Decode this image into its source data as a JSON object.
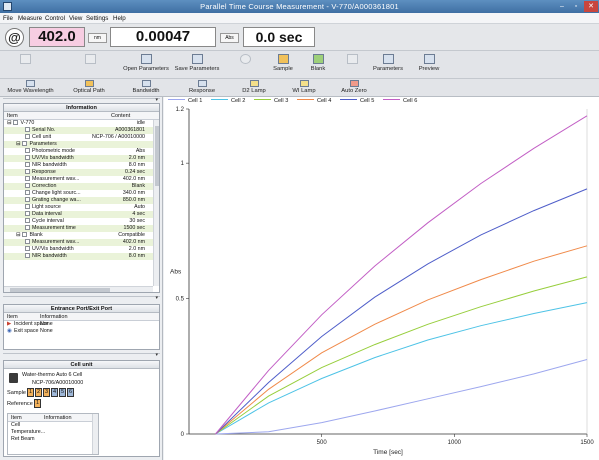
{
  "window": {
    "title": "Parallel Time Course Measurement - V-770/A000361801",
    "minimize": "–",
    "maximize": "▫",
    "close": "✕"
  },
  "menu": [
    "File",
    "Measure",
    "Control",
    "View",
    "Settings",
    "Help"
  ],
  "readout": {
    "logo": "@",
    "wavelength": "402.0",
    "wavelength_unit": "nm",
    "abs_value": "0.00047",
    "abs_unit": "Abs",
    "time": "0.0 sec"
  },
  "toolbar": {
    "items": [
      {
        "label": "",
        "icon": "measure-icon",
        "enabled": false
      },
      {
        "label": "",
        "icon": "table-icon",
        "enabled": false
      },
      {
        "label": "Open Parameters",
        "icon": "folder-open-icon",
        "enabled": true
      },
      {
        "label": "Save Parameters",
        "icon": "save-icon",
        "enabled": true
      },
      {
        "label": "",
        "icon": "stop-icon",
        "enabled": false
      },
      {
        "label": "Sample",
        "icon": "sample-icon",
        "enabled": true
      },
      {
        "label": "Blank",
        "icon": "blank-icon",
        "enabled": true
      },
      {
        "label": "",
        "icon": "print-icon",
        "enabled": false
      },
      {
        "label": "Parameters",
        "icon": "parameters-icon",
        "enabled": true
      },
      {
        "label": "Preview",
        "icon": "preview-icon",
        "enabled": true
      }
    ]
  },
  "toolbar2": {
    "items": [
      "Move Wavelength",
      "Optical Path",
      "Bandwidth",
      "Response",
      "D2 Lamp",
      "WI Lamp",
      "Auto Zero"
    ]
  },
  "information": {
    "title": "Information",
    "col_item": "Item",
    "col_content": "Content",
    "rows": [
      {
        "name": "V-770",
        "value": "idle",
        "indent": 0
      },
      {
        "name": "Serial No.",
        "value": "A000361801",
        "indent": 2
      },
      {
        "name": "Cell unit",
        "value": "NCP-706 / A00010000",
        "indent": 2
      },
      {
        "name": "Parameters",
        "value": "",
        "indent": 1
      },
      {
        "name": "Photometric mode",
        "value": "Abs",
        "indent": 2
      },
      {
        "name": "UV/Vis bandwidth",
        "value": "2.0 nm",
        "indent": 2
      },
      {
        "name": "NIR bandwidth",
        "value": "8.0 nm",
        "indent": 2
      },
      {
        "name": "Response",
        "value": "0.24 sec",
        "indent": 2
      },
      {
        "name": "Measurement wav...",
        "value": "402.0 nm",
        "indent": 2
      },
      {
        "name": "Correction",
        "value": "Blank",
        "indent": 2
      },
      {
        "name": "Change light sourc...",
        "value": "340.0 nm",
        "indent": 2
      },
      {
        "name": "Grating change wa...",
        "value": "850.0 nm",
        "indent": 2
      },
      {
        "name": "Light source",
        "value": "Auto",
        "indent": 2
      },
      {
        "name": "Data interval",
        "value": "4 sec",
        "indent": 2
      },
      {
        "name": "Cycle interval",
        "value": "30 sec",
        "indent": 2
      },
      {
        "name": "Measurement time",
        "value": "1500 sec",
        "indent": 2
      },
      {
        "name": "Blank",
        "value": "Compatible",
        "indent": 1
      },
      {
        "name": "Measurement wav...",
        "value": "402.0 nm",
        "indent": 2
      },
      {
        "name": "UV/Vis bandwidth",
        "value": "2.0 nm",
        "indent": 2
      },
      {
        "name": "NIR bandwidth",
        "value": "8.0 nm",
        "indent": 2
      }
    ]
  },
  "port": {
    "title": "Entrance Port/Exit Port",
    "col_item": "Item",
    "col_info": "Information",
    "rows": [
      {
        "name": "Incident space",
        "value": "None"
      },
      {
        "name": "Exit space",
        "value": "None"
      }
    ]
  },
  "cellunit": {
    "title": "Cell unit",
    "name": "Water-thermo Auto 6 Cell",
    "model": "NCP-706/A00010000",
    "sample_label": "Sample",
    "sample_cells": [
      "1",
      "2",
      "3",
      "4",
      "5",
      "6"
    ],
    "reference_label": "Reference",
    "reference_cells": [
      "1"
    ],
    "col_item": "Item",
    "col_info": "Information",
    "rows": [
      "Cell",
      "Temperature...",
      "Ret Beam"
    ]
  },
  "chart_data": {
    "type": "line",
    "x_label": "Time [sec]",
    "y_label": "Abs",
    "xlim": [
      0,
      1500
    ],
    "ylim": [
      0,
      1.2
    ],
    "x_ticks": [
      500,
      1000,
      1500
    ],
    "y_ticks": [
      0,
      0.5,
      1,
      1.2
    ],
    "legend_placement": "top",
    "series": [
      {
        "name": "Cell 1",
        "color": "#9da7ee",
        "x": [
          100,
          300,
          500,
          700,
          900,
          1100,
          1300,
          1500
        ],
        "y": [
          0,
          0.008,
          0.042,
          0.085,
          0.13,
          0.175,
          0.222,
          0.275
        ]
      },
      {
        "name": "Cell 2",
        "color": "#4ec3e6",
        "x": [
          100,
          300,
          500,
          700,
          900,
          1100,
          1300,
          1500
        ],
        "y": [
          0,
          0.115,
          0.205,
          0.282,
          0.347,
          0.4,
          0.445,
          0.485
        ]
      },
      {
        "name": "Cell 3",
        "color": "#97ce3c",
        "x": [
          100,
          300,
          500,
          700,
          900,
          1100,
          1300,
          1500
        ],
        "y": [
          0,
          0.14,
          0.245,
          0.33,
          0.405,
          0.47,
          0.528,
          0.58
        ]
      },
      {
        "name": "Cell 4",
        "color": "#f08a4a",
        "x": [
          100,
          300,
          500,
          700,
          900,
          1100,
          1300,
          1500
        ],
        "y": [
          0,
          0.165,
          0.3,
          0.405,
          0.495,
          0.57,
          0.638,
          0.695
        ]
      },
      {
        "name": "Cell 5",
        "color": "#4f5ec9",
        "x": [
          100,
          300,
          500,
          700,
          900,
          1100,
          1300,
          1500
        ],
        "y": [
          0,
          0.19,
          0.36,
          0.505,
          0.628,
          0.735,
          0.825,
          0.905
        ]
      },
      {
        "name": "Cell 6",
        "color": "#c25fc5",
        "x": [
          100,
          300,
          500,
          700,
          900,
          1100,
          1300,
          1500
        ],
        "y": [
          0,
          0.235,
          0.44,
          0.62,
          0.78,
          0.925,
          1.055,
          1.175
        ]
      }
    ]
  }
}
